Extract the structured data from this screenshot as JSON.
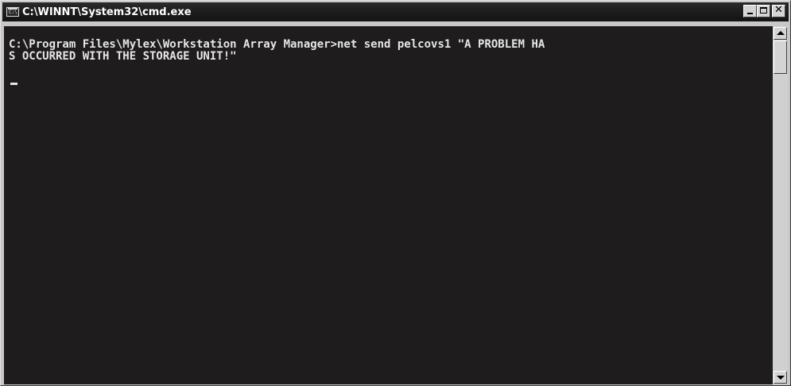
{
  "window": {
    "title": "C:\\WINNT\\System32\\cmd.exe",
    "icon": "cmd-icon",
    "icon_text": "C:\\",
    "buttons": {
      "minimize_icon": "minimize-icon",
      "maximize_icon": "maximize-icon",
      "close_icon": "close-icon",
      "close_glyph": "✕"
    }
  },
  "console": {
    "lines": [
      "C:\\Program Files\\Mylex\\Workstation Array Manager>net send pelcovs1 \"A PROBLEM HA",
      "S OCCURRED WITH THE STORAGE UNIT!\""
    ],
    "background": "#1e1c1d",
    "foreground": "#e6e6e6"
  },
  "scrollbar": {
    "up_icon": "scroll-up-arrow-icon",
    "down_icon": "scroll-down-arrow-icon"
  }
}
